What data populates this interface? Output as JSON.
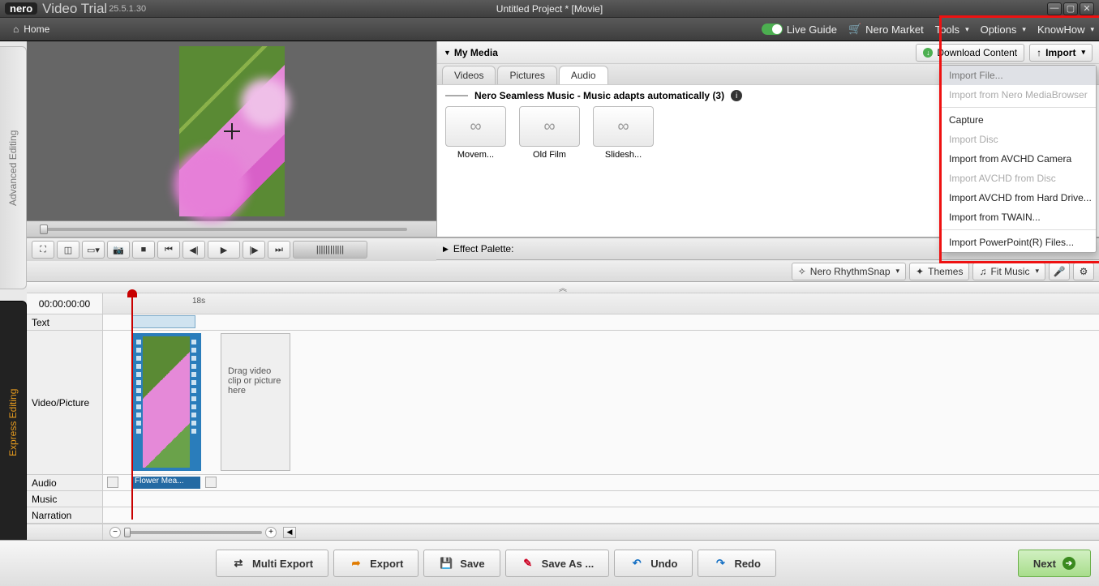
{
  "titlebar": {
    "brand": "nero",
    "app": "Video  Trial",
    "version": "25.5.1.30",
    "project": "Untitled Project * [Movie]"
  },
  "menubar": {
    "home": "Home",
    "liveguide": "Live Guide",
    "market": "Nero Market",
    "tools": "Tools",
    "options": "Options",
    "knowhow": "KnowHow"
  },
  "vtabs": {
    "advanced": "Advanced Editing",
    "express": "Express Editing"
  },
  "preview": {
    "toolbar": [
      "fullscreen",
      "fit",
      "aspect",
      "snapshot",
      "stop",
      "prev-frame",
      "prev",
      "play",
      "next",
      "next-frame",
      "jog"
    ]
  },
  "media": {
    "title": "My Media",
    "download": "Download Content",
    "import": "Import",
    "tabs": {
      "videos": "Videos",
      "pictures": "Pictures",
      "audio": "Audio"
    },
    "seamless": "Nero Seamless Music - Music adapts automatically (3)",
    "items": [
      {
        "label": "Movem..."
      },
      {
        "label": "Old Film"
      },
      {
        "label": "Slidesh..."
      }
    ]
  },
  "dropdown": {
    "import_file": "Import File...",
    "import_mb": "Import from Nero MediaBrowser",
    "capture": "Capture",
    "import_disc": "Import Disc",
    "import_avchd_cam": "Import from AVCHD Camera",
    "import_avchd_disc": "Import AVCHD from Disc",
    "import_avchd_hd": "Import AVCHD from Hard Drive...",
    "import_twain": "Import from TWAIN...",
    "import_ppt": "Import PowerPoint(R) Files..."
  },
  "effect": {
    "title": "Effect Palette:"
  },
  "sec_toolbar": {
    "rhythm": "Nero RhythmSnap",
    "themes": "Themes",
    "fitmusic": "Fit Music"
  },
  "timeline": {
    "time": "00:00:00:00",
    "tick_18s": "18s",
    "rows": {
      "text": "Text",
      "vp": "Video/Picture",
      "audio": "Audio",
      "music": "Music",
      "narration": "Narration"
    },
    "clip_label": "Flower Mea...",
    "dropzone": "Drag  video clip or picture here"
  },
  "bottom": {
    "multi_export": "Multi Export",
    "export": "Export",
    "save": "Save",
    "save_as": "Save As ...",
    "undo": "Undo",
    "redo": "Redo",
    "next": "Next"
  }
}
